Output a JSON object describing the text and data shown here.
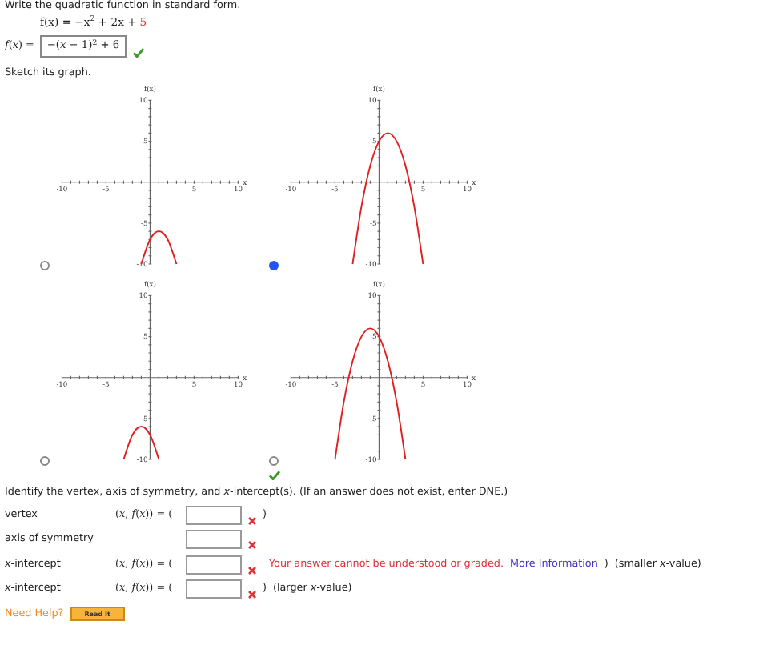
{
  "instruction": "Write the quadratic function in standard form.",
  "equation": {
    "text": "f(x) = −x$^{2}$ + 2x + ",
    "constant": "5"
  },
  "standard_form": {
    "label": "*f*(*x*) =",
    "value": "−(*x* − 1)$^{2}$ + 6",
    "correct": true
  },
  "sketch_prompt": "Sketch its graph.",
  "graphs": [
    {
      "selected": false,
      "chart_data": {
        "type": "line",
        "xlabel": "x",
        "ylabel": "f(x)",
        "xlim": [
          -10,
          10
        ],
        "ylim": [
          -10,
          10
        ],
        "xticks": [
          -10,
          -5,
          5,
          10
        ],
        "yticks": [
          -10,
          -5,
          5,
          10
        ],
        "x": [
          -1,
          0,
          1,
          2,
          3
        ],
        "series": [
          {
            "color": "#e02020",
            "values": [
              -10,
              -7,
              -6,
              -7,
              -10
            ]
          }
        ]
      }
    },
    {
      "selected": true,
      "chart_data": {
        "type": "line",
        "xlabel": "x",
        "ylabel": "f(x)",
        "xlim": [
          -10,
          10
        ],
        "ylim": [
          -10,
          10
        ],
        "xticks": [
          -10,
          -5,
          5,
          10
        ],
        "yticks": [
          -10,
          -5,
          5,
          10
        ],
        "x": [
          -3,
          -2,
          -1,
          0,
          1,
          2,
          3,
          4,
          5
        ],
        "series": [
          {
            "color": "#e02020",
            "values": [
              -10,
              -3,
              2,
              5,
              6,
              5,
              2,
              -3,
              -10
            ]
          }
        ]
      }
    },
    {
      "selected": false,
      "chart_data": {
        "type": "line",
        "xlabel": "x",
        "ylabel": "f(x)",
        "xlim": [
          -10,
          10
        ],
        "ylim": [
          -10,
          10
        ],
        "xticks": [
          -10,
          -5,
          5,
          10
        ],
        "yticks": [
          -10,
          -5,
          5,
          10
        ],
        "x": [
          -3,
          -2,
          -1,
          0,
          1
        ],
        "series": [
          {
            "color": "#e02020",
            "values": [
              -10,
              -7,
              -6,
              -7,
              -10
            ]
          }
        ]
      }
    },
    {
      "selected": false,
      "chart_data": {
        "type": "line",
        "xlabel": "x",
        "ylabel": "f(x)",
        "xlim": [
          -10,
          10
        ],
        "ylim": [
          -10,
          10
        ],
        "xticks": [
          -10,
          -5,
          5,
          10
        ],
        "yticks": [
          -10,
          -5,
          5,
          10
        ],
        "x": [
          -5,
          -4,
          -3,
          -2,
          -1,
          0,
          1,
          2,
          3
        ],
        "series": [
          {
            "color": "#e02020",
            "values": [
              -10,
              -3,
              2,
              5,
              6,
              5,
              2,
              -3,
              -10
            ]
          }
        ]
      }
    }
  ],
  "graph_correct": true,
  "identify_prompt": "Identify the vertex, axis of symmetry, and *x*-intercept(s). (If an answer does not exist, enter DNE.)",
  "answers": [
    {
      "label": "vertex",
      "prefix": "(*x*, *f*(*x*)) = (",
      "correct": false,
      "suffix": ")"
    },
    {
      "label": "axis of symmetry",
      "correct": false
    },
    {
      "label": "*x*-intercept",
      "prefix": "(*x*, *f*(*x*)) = (",
      "correct": false,
      "error": "Your answer cannot be understood or graded.",
      "link": "More Information",
      "suffix": ")",
      "note": "(smaller *x*-value)"
    },
    {
      "label": "*x*-intercept",
      "prefix": "(*x*, *f*(*x*)) = (",
      "correct": false,
      "suffix": ")",
      "note": "(larger *x*-value)"
    }
  ],
  "help": {
    "label": "Need Help?",
    "button": "Read It"
  }
}
